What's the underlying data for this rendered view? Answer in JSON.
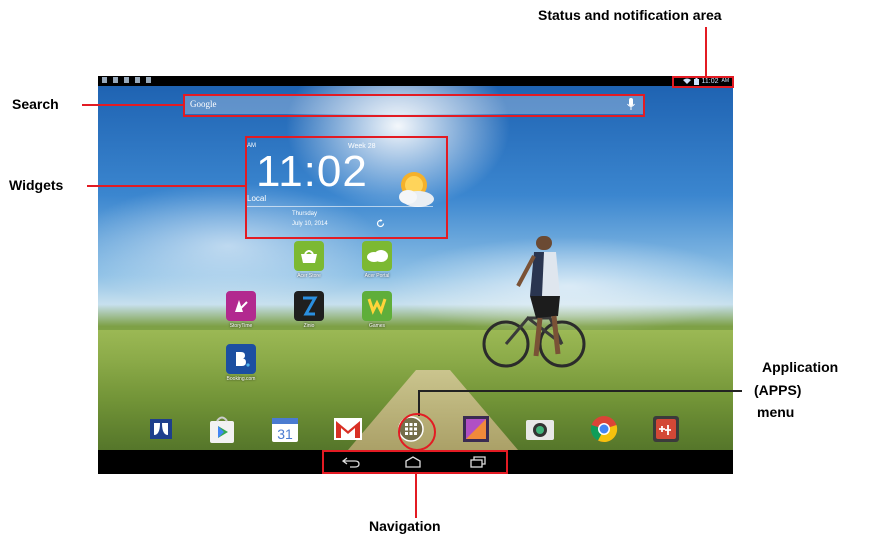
{
  "annotations": {
    "status": "Status and notification area",
    "search": "Search",
    "widgets": "Widgets",
    "apps_line1": "Application",
    "apps_line2": "(APPS)",
    "apps_line3": "menu",
    "navigation": "Navigation"
  },
  "status_bar": {
    "time": "11:02",
    "ampm": "AM"
  },
  "search": {
    "label": "Google"
  },
  "clock_widget": {
    "am": "AM",
    "week": "Week 28",
    "time": "11:02",
    "location": "Local",
    "day": "Thursday",
    "date": "July 10, 2014"
  },
  "apps": [
    {
      "label": "Acer Store"
    },
    {
      "label": "Acer Portal"
    },
    {
      "label": "StoryTime"
    },
    {
      "label": "Zinio"
    },
    {
      "label": "Games"
    },
    {
      "label": "Booking.com"
    }
  ],
  "dock": {
    "calendar_day": "31"
  },
  "colors": {
    "annotation": "#e31b23",
    "status_text": "#cfe4ff"
  }
}
